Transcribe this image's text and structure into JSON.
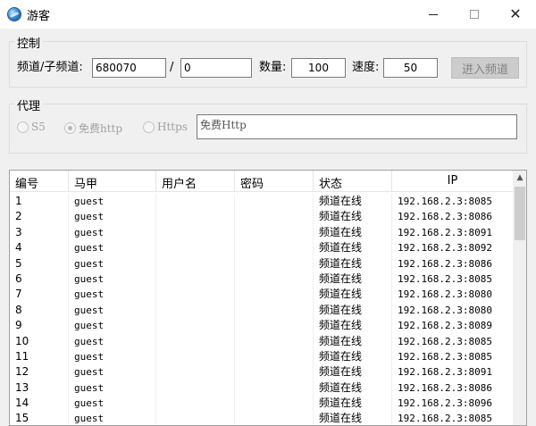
{
  "window": {
    "title": "游客",
    "icon": "globe-icon",
    "min": "minimize-icon",
    "max": "maximize-icon",
    "close_label": "✕"
  },
  "control": {
    "legend": "控制",
    "channel_label": "频道/子频道:",
    "channel_value": "680070",
    "separator": "/",
    "subchannel_value": "0",
    "count_label": "数量:",
    "count_value": "100",
    "speed_label": "速度:",
    "speed_value": "50",
    "enter_button": "进入频道"
  },
  "proxy": {
    "legend": "代理",
    "options": [
      {
        "label": "S5",
        "checked": false
      },
      {
        "label": "免费http",
        "checked": true
      },
      {
        "label": "Https",
        "checked": false
      }
    ],
    "text_value": "免费Http"
  },
  "table": {
    "headers": [
      "编号",
      "马甲",
      "用户名",
      "密码",
      "状态",
      "IP"
    ],
    "rows": [
      [
        "1",
        "guest",
        "",
        "",
        "频道在线",
        "192.168.2.3:8085"
      ],
      [
        "2",
        "guest",
        "",
        "",
        "频道在线",
        "192.168.2.3:8086"
      ],
      [
        "3",
        "guest",
        "",
        "",
        "频道在线",
        "192.168.2.3:8091"
      ],
      [
        "4",
        "guest",
        "",
        "",
        "频道在线",
        "192.168.2.3:8092"
      ],
      [
        "5",
        "guest",
        "",
        "",
        "频道在线",
        "192.168.2.3:8086"
      ],
      [
        "6",
        "guest",
        "",
        "",
        "频道在线",
        "192.168.2.3:8085"
      ],
      [
        "7",
        "guest",
        "",
        "",
        "频道在线",
        "192.168.2.3:8080"
      ],
      [
        "8",
        "guest",
        "",
        "",
        "频道在线",
        "192.168.2.3:8080"
      ],
      [
        "9",
        "guest",
        "",
        "",
        "频道在线",
        "192.168.2.3:8089"
      ],
      [
        "10",
        "guest",
        "",
        "",
        "频道在线",
        "192.168.2.3:8085"
      ],
      [
        "11",
        "guest",
        "",
        "",
        "频道在线",
        "192.168.2.3:8085"
      ],
      [
        "12",
        "guest",
        "",
        "",
        "频道在线",
        "192.168.2.3:8091"
      ],
      [
        "13",
        "guest",
        "",
        "",
        "频道在线",
        "192.168.2.3:8086"
      ],
      [
        "14",
        "guest",
        "",
        "",
        "频道在线",
        "192.168.2.3:8096"
      ],
      [
        "15",
        "guest",
        "",
        "",
        "频道在线",
        "192.168.2.3:8085"
      ]
    ],
    "scroll_up": "▲"
  }
}
